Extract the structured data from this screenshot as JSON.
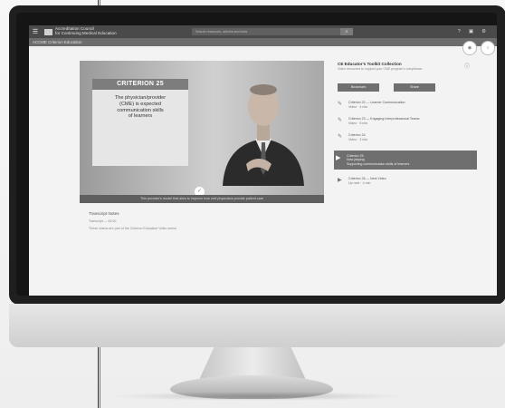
{
  "app": {
    "brand_line1": "Accreditation Council",
    "brand_line2": "for Continuing Medical Education",
    "search_placeholder": "Search resources, articles and tools",
    "search_button": "⌕",
    "icons": [
      "question-icon",
      "bell-icon",
      "settings-icon"
    ],
    "icon_glyphs": [
      "?",
      "▣",
      "⚙"
    ]
  },
  "subbar": {
    "label": "ACCME Criterion Education"
  },
  "circles": [
    "◉",
    "○"
  ],
  "video": {
    "card_heading": "CRITERION 25",
    "card_body_lines": [
      "The physician/provider",
      "(CME) is expected",
      "communication skills",
      "of learners"
    ],
    "caption": "This provider's model that aims to improve how well physicians provide patient care"
  },
  "transcript": {
    "title": "Transcript Notes",
    "small": "Transcript — 00:00",
    "line": "These videos are part of the Criterion Education Video series"
  },
  "side": {
    "title": "CE Educator's Toolkit Collection",
    "subtitle": "Video resources to support your CME program's compliance",
    "info_icon": "ⓘ",
    "buttons": [
      "Bookmark",
      "Share"
    ],
    "items": [
      {
        "icon": "✎",
        "line1": "Criterion 22 — Learner Communication",
        "line2": "Video · 4 min"
      },
      {
        "icon": "✎",
        "line1": "Criterion 23 — Engaging Interprofessional Teams",
        "line2": "Video · 5 min"
      },
      {
        "icon": "✎",
        "line1": "Criterion 24",
        "line2": "Video · 3 min"
      }
    ],
    "active": {
      "icon": "▶",
      "line1": "Criterion 25",
      "line2": "Now playing",
      "line3": "Supporting communication skills of learners"
    },
    "after": {
      "icon": "▶",
      "line1": "Criterion 26 — Next Video",
      "line2": "Up next · 4 min"
    }
  }
}
